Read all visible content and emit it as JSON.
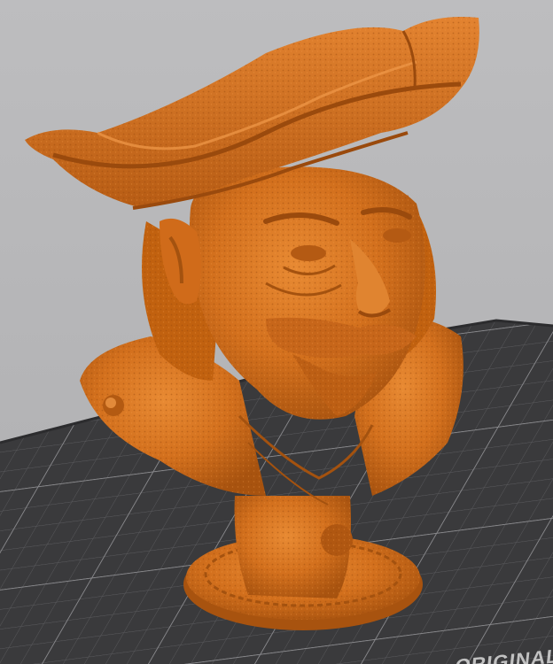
{
  "viewport": {
    "background_color": "#b9b9bb",
    "model": {
      "name": "",
      "color": "#d8741f",
      "subject": "pirate-bust"
    },
    "bed": {
      "color": "#3a3a3c",
      "grid_color": "#6d6d70",
      "label": "ORIGINAL"
    }
  }
}
